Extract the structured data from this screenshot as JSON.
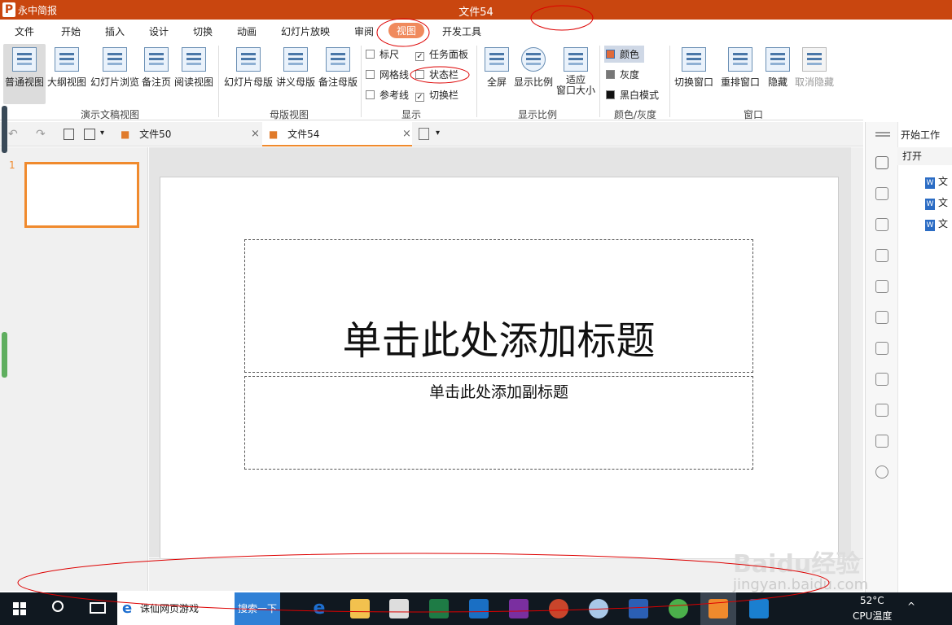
{
  "app": {
    "name": "永中简报",
    "logo": "P"
  },
  "window": {
    "title": "文件54"
  },
  "menu": [
    "文件",
    "开始",
    "插入",
    "设计",
    "切换",
    "动画",
    "幻灯片放映",
    "审阅",
    "视图",
    "开发工具"
  ],
  "menu_active": "视图",
  "ribbon": {
    "views": [
      "普通视图",
      "大纲视图",
      "幻灯片浏览",
      "备注页",
      "阅读视图"
    ],
    "views_group": "演示文稿视图",
    "masters": [
      "幻灯片母版",
      "讲义母版",
      "备注母版"
    ],
    "masters_group": "母版视图",
    "show_left": [
      {
        "label": "标尺",
        "checked": false
      },
      {
        "label": "网格线",
        "checked": false
      },
      {
        "label": "参考线",
        "checked": false
      }
    ],
    "show_right": [
      {
        "label": "任务面板",
        "checked": true
      },
      {
        "label": "状态栏",
        "checked": false
      },
      {
        "label": "切换栏",
        "checked": true
      }
    ],
    "show_group": "显示",
    "zoom": [
      "全屏",
      "显示比例",
      "适应",
      "窗口大小"
    ],
    "zoom_group": "显示比例",
    "color": [
      "颜色",
      "灰度",
      "黑白模式"
    ],
    "color_group": "颜色/灰度",
    "window": [
      "切换窗口",
      "重排窗口",
      "隐藏",
      "取消隐藏"
    ],
    "window_group": "窗口"
  },
  "tabs": [
    {
      "label": "文件50",
      "active": false
    },
    {
      "label": "文件54",
      "active": true
    }
  ],
  "slide": {
    "number": "1",
    "title": "单击此处添加标题",
    "subtitle": "单击此处添加副标题"
  },
  "taskpane": {
    "title": "开始工作",
    "open": "打开",
    "doc_prefix": "文"
  },
  "taskbar": {
    "search_text": "诛仙网页游戏",
    "search_button": "搜索一下",
    "temperature": "52°C",
    "cpu": "CPU温度"
  },
  "watermark": {
    "brand": "Baidu经验",
    "url": "jingyan.baidu.com"
  }
}
